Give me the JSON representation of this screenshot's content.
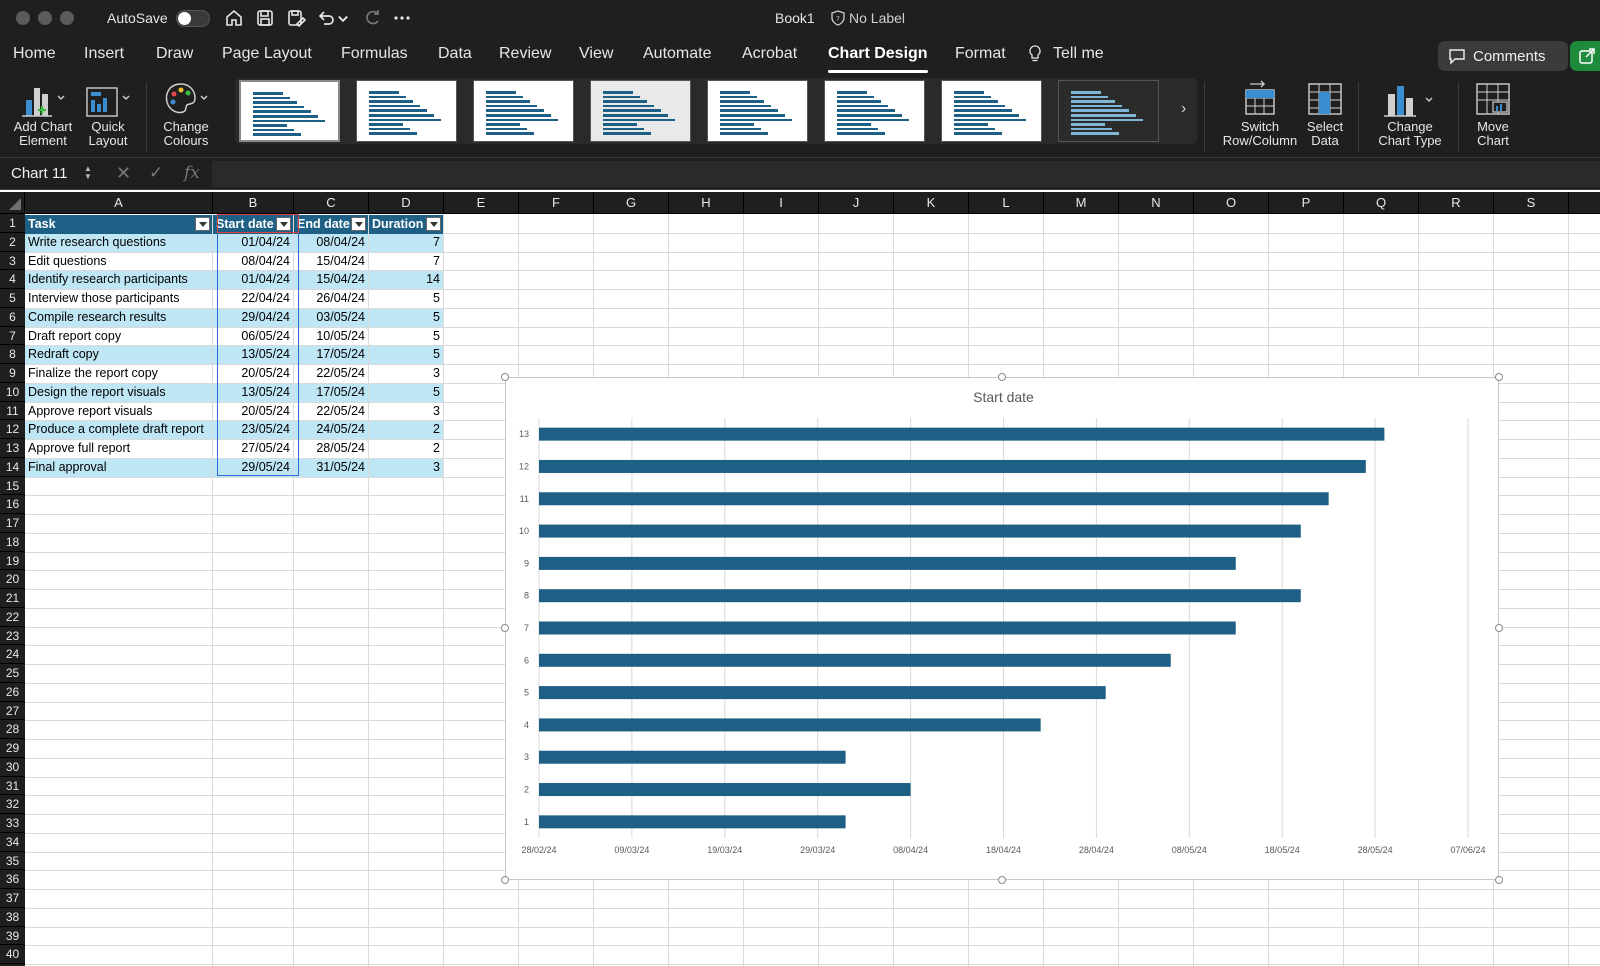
{
  "titlebar": {
    "autosave_label": "AutoSave",
    "doc_title": "Book1",
    "sensitivity_label": "No Label"
  },
  "tabs": [
    "Home",
    "Insert",
    "Draw",
    "Page Layout",
    "Formulas",
    "Data",
    "Review",
    "View",
    "Automate",
    "Acrobat",
    "Chart Design",
    "Format",
    "Tell me"
  ],
  "active_tab": "Chart Design",
  "comments_label": "Comments",
  "ribbon": {
    "add_chart_element": "Add Chart\nElement",
    "quick_layout": "Quick\nLayout",
    "change_colours": "Change\nColours",
    "switch_row_column": "Switch\nRow/Column",
    "select_data": "Select\nData",
    "change_chart_type": "Change\nChart Type",
    "move_chart": "Move\nChart"
  },
  "formula_bar": {
    "name_box": "Chart 11",
    "fx_label": "fx"
  },
  "columns": [
    "A",
    "B",
    "C",
    "D",
    "E",
    "F",
    "G",
    "H",
    "I",
    "J",
    "K",
    "L",
    "M",
    "N",
    "O",
    "P",
    "Q",
    "R",
    "S"
  ],
  "rows": [
    "1",
    "2",
    "3",
    "4",
    "5",
    "6",
    "7",
    "8",
    "9",
    "10",
    "11",
    "12",
    "13",
    "14",
    "15",
    "16",
    "17",
    "18",
    "19",
    "20",
    "21",
    "22",
    "23",
    "24",
    "25",
    "26",
    "27",
    "28",
    "29",
    "30",
    "31",
    "32",
    "33",
    "34",
    "35",
    "36",
    "37",
    "38",
    "39",
    "40"
  ],
  "table": {
    "headers": [
      "Task",
      "Start date",
      "End date",
      "Duration"
    ],
    "rows": [
      [
        "Write research questions",
        "01/04/24",
        "08/04/24",
        "7"
      ],
      [
        "Edit questions",
        "08/04/24",
        "15/04/24",
        "7"
      ],
      [
        "Identify research participants",
        "01/04/24",
        "15/04/24",
        "14"
      ],
      [
        "Interview those participants",
        "22/04/24",
        "26/04/24",
        "5"
      ],
      [
        "Compile research results",
        "29/04/24",
        "03/05/24",
        "5"
      ],
      [
        "Draft report copy",
        "06/05/24",
        "10/05/24",
        "5"
      ],
      [
        "Redraft copy",
        "13/05/24",
        "17/05/24",
        "5"
      ],
      [
        "Finalize the report copy",
        "20/05/24",
        "22/05/24",
        "3"
      ],
      [
        "Design the report visuals",
        "13/05/24",
        "17/05/24",
        "5"
      ],
      [
        "Approve report visuals",
        "20/05/24",
        "22/05/24",
        "3"
      ],
      [
        "Produce a complete draft report",
        "23/05/24",
        "24/05/24",
        "2"
      ],
      [
        "Approve full report",
        "27/05/24",
        "28/05/24",
        "2"
      ],
      [
        "Final approval",
        "29/05/24",
        "31/05/24",
        "3"
      ]
    ]
  },
  "chart_data": {
    "type": "bar",
    "orientation": "horizontal",
    "title": "Start date",
    "categories": [
      "1",
      "2",
      "3",
      "4",
      "5",
      "6",
      "7",
      "8",
      "9",
      "10",
      "11",
      "12",
      "13"
    ],
    "values": [
      "01/04/24",
      "08/04/24",
      "01/04/24",
      "22/04/24",
      "29/04/24",
      "06/05/24",
      "13/05/24",
      "20/05/24",
      "13/05/24",
      "20/05/24",
      "23/05/24",
      "27/05/24",
      "29/05/24"
    ],
    "x_ticks": [
      "28/02/24",
      "09/03/24",
      "19/03/24",
      "29/03/24",
      "08/04/24",
      "18/04/24",
      "28/04/24",
      "08/05/24",
      "18/05/24",
      "28/05/24",
      "07/06/24"
    ],
    "xlim": [
      "28/02/24",
      "07/06/24"
    ],
    "grid": true,
    "legend": "none",
    "bar_color": "#1d5f85"
  },
  "colors": {
    "accent": "#1d5f85",
    "table_band": "#bfe6f5",
    "ribbon_bg": "#1f1f1f",
    "share_green": "#1e8a3c"
  }
}
